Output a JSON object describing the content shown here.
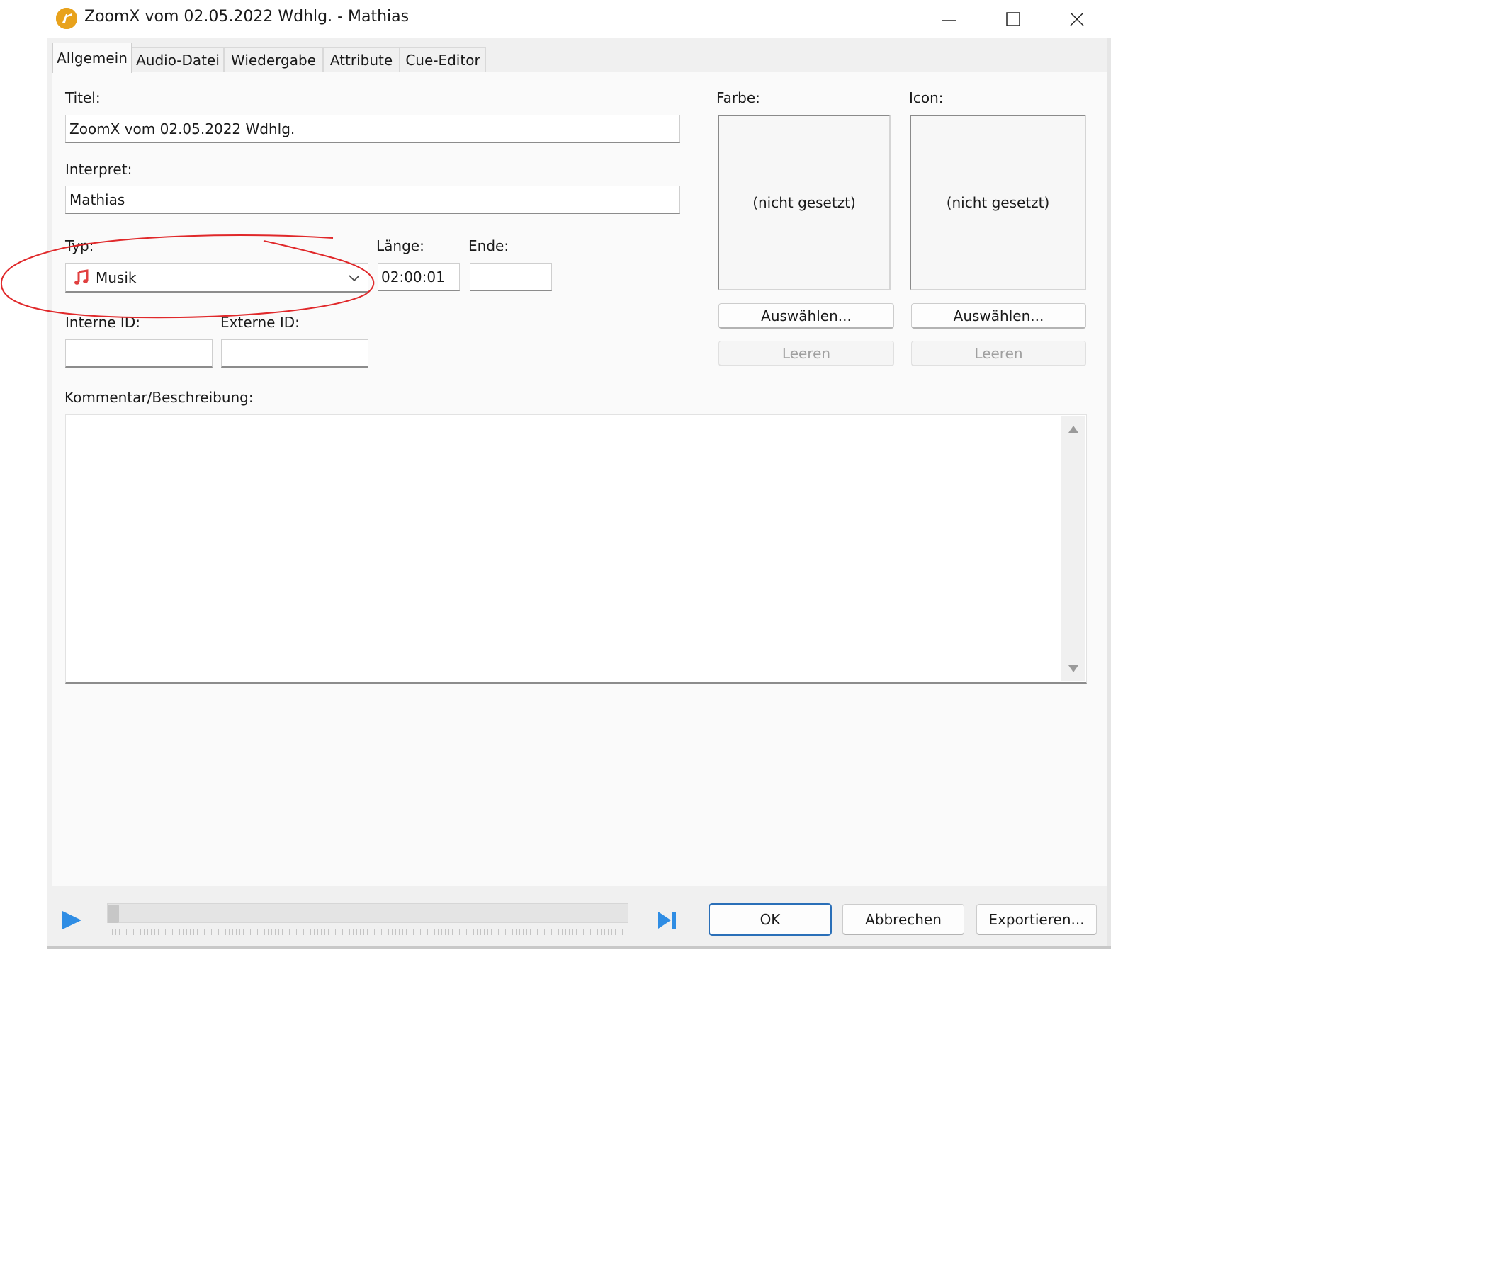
{
  "window": {
    "title": "ZoomX vom 02.05.2022 Wdhlg. - Mathias"
  },
  "tabs": [
    {
      "label": "Allgemein",
      "active": true
    },
    {
      "label": "Audio-Datei",
      "active": false
    },
    {
      "label": "Wiedergabe",
      "active": false
    },
    {
      "label": "Attribute",
      "active": false
    },
    {
      "label": "Cue-Editor",
      "active": false
    }
  ],
  "form": {
    "titel_label": "Titel:",
    "titel_value": "ZoomX vom 02.05.2022 Wdhlg.",
    "interpret_label": "Interpret:",
    "interpret_value": "Mathias",
    "typ_label": "Typ:",
    "typ_value": "Musik",
    "laenge_label": "Länge:",
    "laenge_value": "02:00:01",
    "ende_label": "Ende:",
    "ende_value": "",
    "interne_id_label": "Interne ID:",
    "interne_id_value": "",
    "externe_id_label": "Externe ID:",
    "externe_id_value": "",
    "kommentar_label": "Kommentar/Beschreibung:",
    "kommentar_value": ""
  },
  "farbe": {
    "label": "Farbe:",
    "value": "(nicht gesetzt)",
    "select_label": "Auswählen...",
    "clear_label": "Leeren"
  },
  "icon": {
    "label": "Icon:",
    "value": "(nicht gesetzt)",
    "select_label": "Auswählen...",
    "clear_label": "Leeren"
  },
  "footer": {
    "ok_label": "OK",
    "cancel_label": "Abbrechen",
    "export_label": "Exportieren..."
  },
  "icons": {
    "app": "app-logo-icon",
    "type": "music-note-icon",
    "play": "play-icon",
    "skip": "skip-to-end-icon"
  },
  "colors": {
    "accent": "#2f8de4",
    "annotation": "#e0282a",
    "music_icon": "#e04040",
    "ok_border": "#2a6fb8"
  }
}
